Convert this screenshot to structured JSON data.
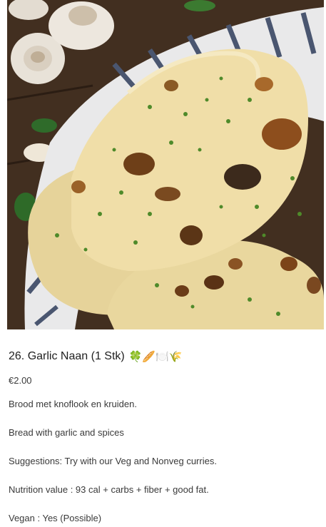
{
  "image": {
    "alt": "Garlic naan bread in a basket with garlic bulbs"
  },
  "item": {
    "title": "26. Garlic Naan (1 Stk)",
    "emojis": "🍀🥖🍽️🌾",
    "price": "€2.00",
    "lines": [
      "Brood met knoflook en kruiden.",
      "Bread with garlic and spices",
      "Suggestions: Try with our Veg and Nonveg curries.",
      "Nutrition value : 93 cal + carbs + fiber + good fat.",
      "Vegan : Yes (Possible)"
    ]
  }
}
